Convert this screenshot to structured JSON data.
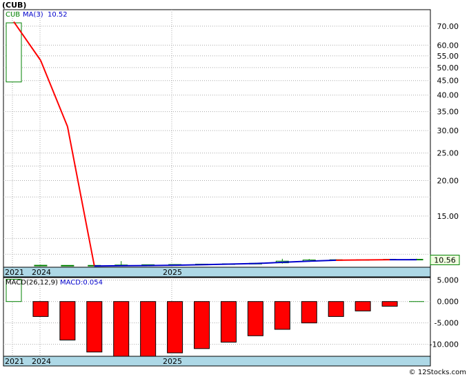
{
  "header": {
    "title": "(CUB)"
  },
  "footer": {
    "credit": "© 12Stocks.com"
  },
  "chart_data": [
    {
      "type": "candlestick",
      "legend": {
        "symbol": "CUB",
        "ma_label": "MA(3)",
        "ma_value": "10.52"
      },
      "scale": "log",
      "ylim": [
        9.9,
        80
      ],
      "y_ticks": [
        "70.00",
        "60.00",
        "55.00",
        "50.00",
        "45.00",
        "40.00",
        "35.00",
        "30.00",
        "25.00",
        "20.00",
        "15.00"
      ],
      "tick_values": [
        70,
        60,
        55,
        50,
        45,
        40,
        35,
        30,
        25,
        20,
        15
      ],
      "last_price_label": "10.56",
      "x_labels": [
        {
          "label": "2021",
          "index": 0
        },
        {
          "label": "2024",
          "index": 1
        },
        {
          "label": "2025",
          "index": 6
        }
      ],
      "candles": [
        {
          "open": 44.5,
          "high": 71.9,
          "low": 44.5,
          "close": 71.9
        },
        {
          "open": 10.02,
          "high": 10.1,
          "low": 10.0,
          "close": 10.06
        },
        {
          "open": 10.04,
          "high": 10.06,
          "low": 10.02,
          "close": 10.05
        },
        {
          "open": 10.03,
          "high": 10.1,
          "low": 9.98,
          "close": 10.05
        },
        {
          "open": 10.05,
          "high": 10.4,
          "low": 10.0,
          "close": 10.08
        },
        {
          "open": 10.08,
          "high": 10.12,
          "low": 10.04,
          "close": 10.1
        },
        {
          "open": 10.1,
          "high": 10.14,
          "low": 10.06,
          "close": 10.12
        },
        {
          "open": 10.12,
          "high": 10.18,
          "low": 10.08,
          "close": 10.15
        },
        {
          "open": 10.15,
          "high": 10.2,
          "low": 10.1,
          "close": 10.18
        },
        {
          "open": 10.2,
          "high": 10.26,
          "low": 10.16,
          "close": 10.22
        },
        {
          "open": 10.26,
          "high": 10.6,
          "low": 10.2,
          "close": 10.4
        },
        {
          "open": 10.4,
          "high": 10.58,
          "low": 10.34,
          "close": 10.5
        },
        {
          "open": 10.48,
          "high": 10.56,
          "low": 10.44,
          "close": 10.52
        },
        {
          "open": 10.5,
          "high": 10.56,
          "low": 10.46,
          "close": 10.53
        },
        {
          "open": 10.53,
          "high": 10.58,
          "low": 10.5,
          "close": 10.56
        },
        {
          "open": 10.54,
          "high": 10.6,
          "low": 10.5,
          "close": 10.56
        }
      ],
      "ma": [
        72.5,
        53.0,
        31.0,
        10.0,
        10.02,
        10.03,
        10.06,
        10.1,
        10.15,
        10.2,
        10.3,
        10.4,
        10.48,
        10.5,
        10.52,
        10.52
      ]
    },
    {
      "type": "bar",
      "legend": {
        "label": "MACD(26,12,9)",
        "value_label": "MACD:0.054"
      },
      "ylim": [
        -12.8,
        5.6
      ],
      "y_ticks": [
        "5.000",
        "0.000",
        "-5.000",
        "-10.000"
      ],
      "tick_values": [
        5,
        0,
        -5,
        -10
      ],
      "x_labels": [
        {
          "label": "2021",
          "index": 0
        },
        {
          "label": "2024",
          "index": 1
        },
        {
          "label": "2025",
          "index": 6
        }
      ],
      "values": [
        5.2,
        -3.5,
        -9.0,
        -11.8,
        -13.0,
        -13.0,
        -12.0,
        -11.0,
        -9.5,
        -8.0,
        -6.5,
        -5.0,
        -3.5,
        -2.2,
        -1.1,
        0.054
      ]
    }
  ],
  "colors": {
    "background": "#ffffff",
    "grid": "#a9a9a9",
    "up_candle": "#008000",
    "ma_down": "#ff0000",
    "ma_flat": "#0000cc",
    "bar_neg": "#ff0000",
    "bar_pos": "#ffffff",
    "date_band": "#add8e6"
  }
}
